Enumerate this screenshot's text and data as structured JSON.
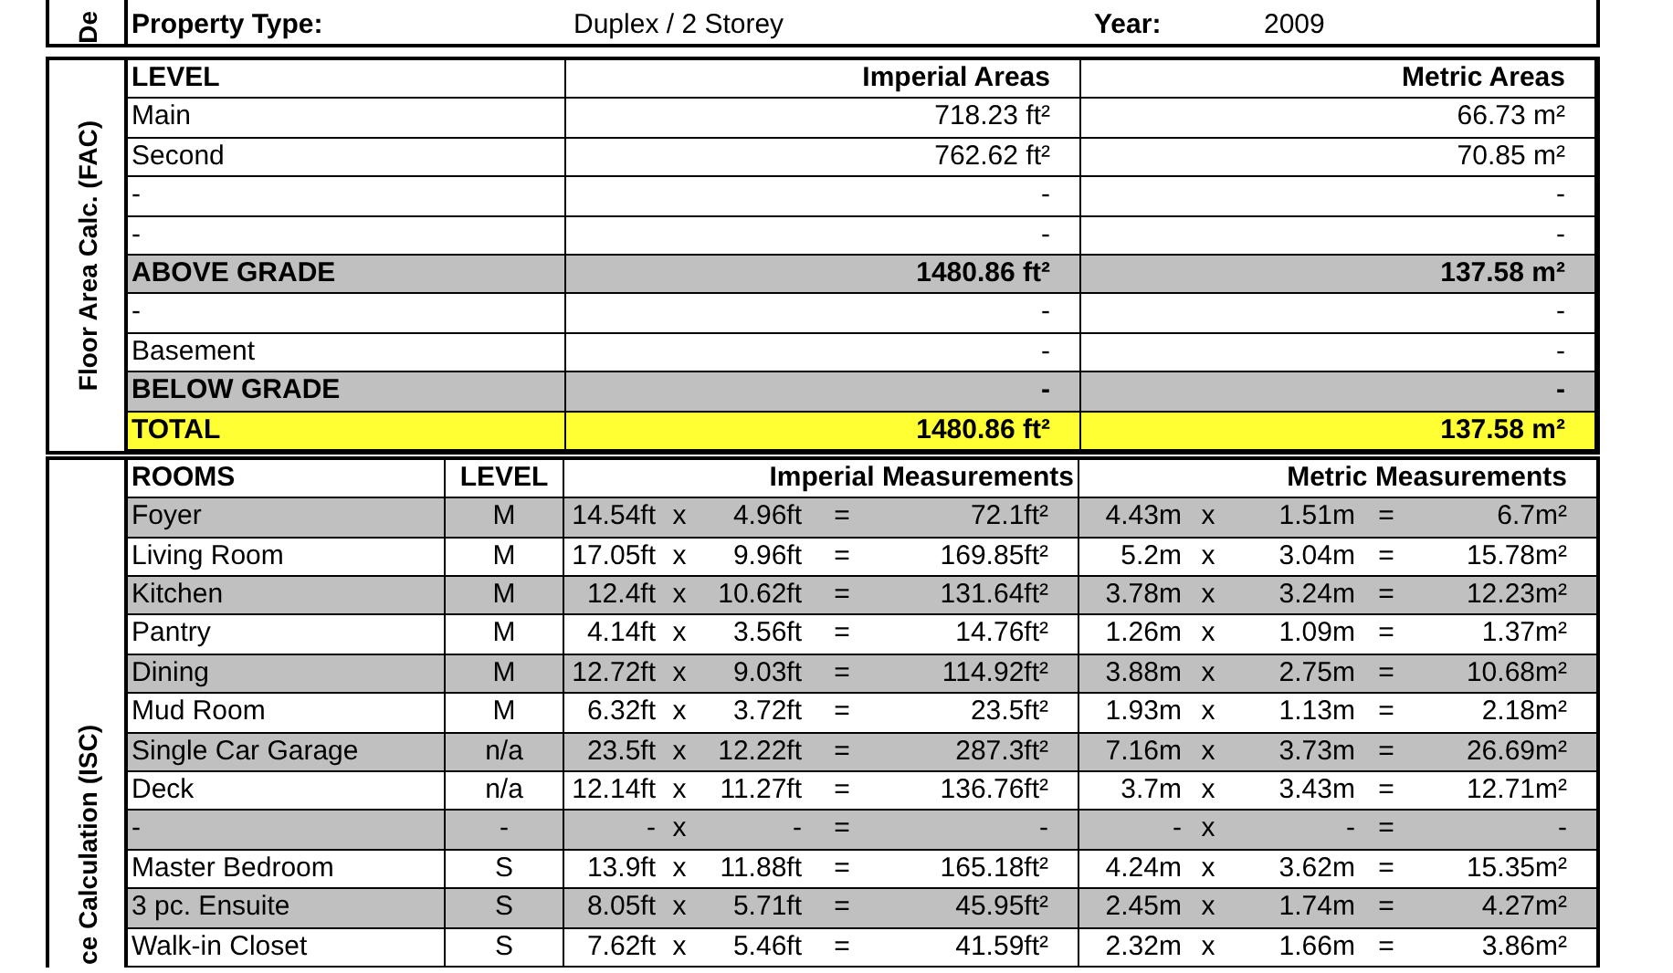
{
  "details": {
    "side_label": "De",
    "property_type_label": "Property Type:",
    "property_type": "Duplex / 2 Storey",
    "year_label": "Year:",
    "year": "2009"
  },
  "floor_area": {
    "side_label": "Floor Area Calc. (FAC)",
    "columns": [
      "LEVEL",
      "Imperial Areas",
      "Metric Areas"
    ],
    "rows": [
      {
        "kind": "level",
        "level": "Main",
        "imperial": "718.23 ft²",
        "metric": "66.73 m²"
      },
      {
        "kind": "level",
        "level": "Second",
        "imperial": "762.62 ft²",
        "metric": "70.85 m²"
      },
      {
        "kind": "level",
        "level": "-",
        "imperial": "-",
        "metric": "-"
      },
      {
        "kind": "level",
        "level": "-",
        "imperial": "-",
        "metric": "-"
      },
      {
        "kind": "subtotal",
        "level": "ABOVE GRADE",
        "imperial": "1480.86 ft²",
        "metric": "137.58 m²"
      },
      {
        "kind": "level",
        "level": "-",
        "imperial": "-",
        "metric": "-"
      },
      {
        "kind": "level",
        "level": "Basement",
        "imperial": "-",
        "metric": "-"
      },
      {
        "kind": "subtotal",
        "level": "BELOW GRADE",
        "imperial": "-",
        "metric": "-"
      },
      {
        "kind": "total",
        "level": "TOTAL",
        "imperial": "1480.86 ft²",
        "metric": "137.58 m²"
      }
    ]
  },
  "rooms": {
    "side_label": "ce Calculation (ISC)",
    "columns": [
      "ROOMS",
      "LEVEL",
      "Imperial Measurements",
      "Metric Measurements"
    ],
    "rows": [
      {
        "shaded": true,
        "room": "Foyer",
        "level": "M",
        "imperial": [
          "14.54ft",
          "x",
          "4.96ft",
          "=",
          "72.1ft²"
        ],
        "metric": [
          "4.43m",
          "x",
          "1.51m",
          "=",
          "6.7m²"
        ]
      },
      {
        "shaded": false,
        "room": "Living Room",
        "level": "M",
        "imperial": [
          "17.05ft",
          "x",
          "9.96ft",
          "=",
          "169.85ft²"
        ],
        "metric": [
          "5.2m",
          "x",
          "3.04m",
          "=",
          "15.78m²"
        ]
      },
      {
        "shaded": true,
        "room": "Kitchen",
        "level": "M",
        "imperial": [
          "12.4ft",
          "x",
          "10.62ft",
          "=",
          "131.64ft²"
        ],
        "metric": [
          "3.78m",
          "x",
          "3.24m",
          "=",
          "12.23m²"
        ]
      },
      {
        "shaded": false,
        "room": "Pantry",
        "level": "M",
        "imperial": [
          "4.14ft",
          "x",
          "3.56ft",
          "=",
          "14.76ft²"
        ],
        "metric": [
          "1.26m",
          "x",
          "1.09m",
          "=",
          "1.37m²"
        ]
      },
      {
        "shaded": true,
        "room": "Dining",
        "level": "M",
        "imperial": [
          "12.72ft",
          "x",
          "9.03ft",
          "=",
          "114.92ft²"
        ],
        "metric": [
          "3.88m",
          "x",
          "2.75m",
          "=",
          "10.68m²"
        ]
      },
      {
        "shaded": false,
        "room": "Mud Room",
        "level": "M",
        "imperial": [
          "6.32ft",
          "x",
          "3.72ft",
          "=",
          "23.5ft²"
        ],
        "metric": [
          "1.93m",
          "x",
          "1.13m",
          "=",
          "2.18m²"
        ]
      },
      {
        "shaded": true,
        "room": "Single Car Garage",
        "level": "n/a",
        "imperial": [
          "23.5ft",
          "x",
          "12.22ft",
          "=",
          "287.3ft²"
        ],
        "metric": [
          "7.16m",
          "x",
          "3.73m",
          "=",
          "26.69m²"
        ]
      },
      {
        "shaded": false,
        "room": "Deck",
        "level": "n/a",
        "imperial": [
          "12.14ft",
          "x",
          "11.27ft",
          "=",
          "136.76ft²"
        ],
        "metric": [
          "3.7m",
          "x",
          "3.43m",
          "=",
          "12.71m²"
        ]
      },
      {
        "shaded": true,
        "room": "-",
        "level": "-",
        "imperial": [
          "-",
          "x",
          "-",
          "=",
          "-"
        ],
        "metric": [
          "-",
          "x",
          "-",
          "=",
          "-"
        ]
      },
      {
        "shaded": false,
        "room": "Master Bedroom",
        "level": "S",
        "imperial": [
          "13.9ft",
          "x",
          "11.88ft",
          "=",
          "165.18ft²"
        ],
        "metric": [
          "4.24m",
          "x",
          "3.62m",
          "=",
          "15.35m²"
        ]
      },
      {
        "shaded": true,
        "room": "3 pc. Ensuite",
        "level": "S",
        "imperial": [
          "8.05ft",
          "x",
          "5.71ft",
          "=",
          "45.95ft²"
        ],
        "metric": [
          "2.45m",
          "x",
          "1.74m",
          "=",
          "4.27m²"
        ]
      },
      {
        "shaded": false,
        "room": "Walk-in Closet",
        "level": "S",
        "imperial": [
          "7.62ft",
          "x",
          "5.46ft",
          "=",
          "41.59ft²"
        ],
        "metric": [
          "2.32m",
          "x",
          "1.66m",
          "=",
          "3.86m²"
        ]
      }
    ]
  }
}
